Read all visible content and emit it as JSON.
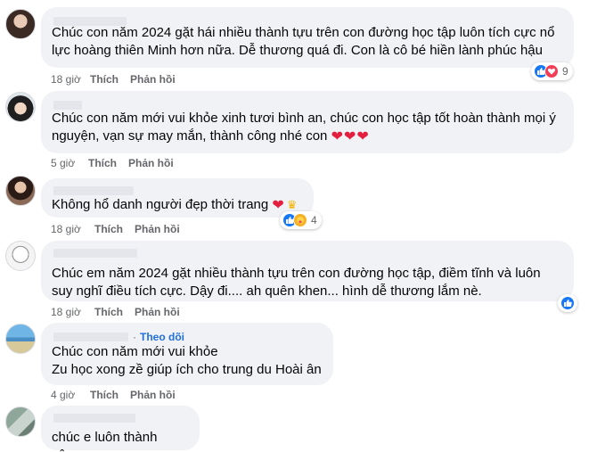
{
  "reply_label": "Phản hồi",
  "like_label": "Thích",
  "follow_label": "Theo dõi",
  "comments": [
    {
      "text": "Chúc con năm 2024 gặt hái nhiều thành tựu trên con đường học tập luôn tích cực nổ lực hoàng thiên Minh hơn nữa. Dễ thương quá đi. Con là cô bé hiền lành phúc hậu",
      "time": "18 giờ",
      "reaction_count": "9",
      "reaction_icons": [
        "like-icon",
        "love-icon"
      ]
    },
    {
      "text": "Chúc con năm mới vui khỏe xinh tươi bình an, chúc con học tập tốt hoàn thành mọi ý nguyện, vạn sự may mắn, thành công nhé con",
      "emoji": "❤❤❤",
      "time": "5 giờ"
    },
    {
      "text": "Không hổ danh người đẹp thời trang",
      "emoji": "❤",
      "time": "18 giờ",
      "reaction_count": "4",
      "reaction_icons": [
        "like-icon",
        "care-icon"
      ]
    },
    {
      "text": "Chúc em năm 2024 gặt nhiều thành tựu trên con đường học tập, điềm tĩnh và luôn suy nghĩ điều tích cực. Dậy đi.... ah quên khen... hình dễ thương lắm nè.",
      "time": "18 giờ",
      "reaction_icons": [
        "like-icon"
      ]
    },
    {
      "text": "Chúc con năm mới vui khỏe\nZu học xong zề giúp ích cho trung du Hoài ân",
      "time": "4 giờ"
    },
    {
      "text": "chúc e luôn thành công"
    }
  ],
  "colors": {
    "bubble": "#f0f2f5",
    "meta_text": "#65676b",
    "link": "#216fdb",
    "like_blue": "#1877f2",
    "love_red": "#f33e58",
    "heart": "#e41e3f"
  }
}
